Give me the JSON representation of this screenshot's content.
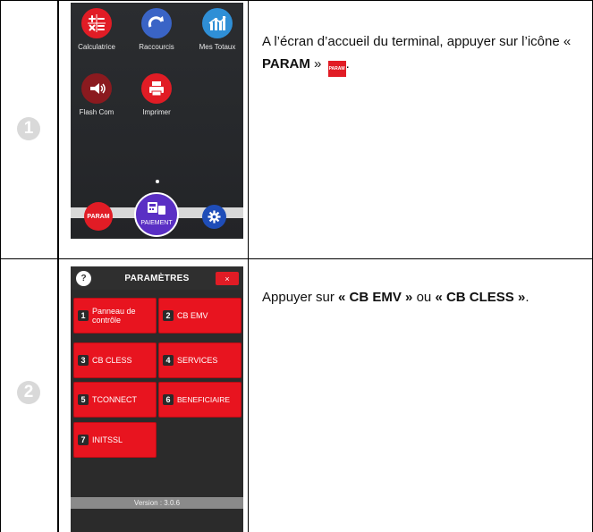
{
  "steps": [
    {
      "number": "1",
      "text_before": "A l’écran d’accueil du terminal, appuyer sur l’icône « ",
      "text_bold": "PARAM",
      "text_after": " »",
      "text_end": ".",
      "inline_icon_label": "PARAM",
      "screen": {
        "apps": [
          {
            "label": "Calculatrice",
            "icon": "calculator-icon",
            "color": "#e11c25"
          },
          {
            "label": "Raccourcis",
            "icon": "redo-arrow-icon",
            "color": "#3a64c6"
          },
          {
            "label": "Mes Totaux",
            "icon": "bar-chart-icon",
            "color": "#2f8fd6"
          },
          {
            "label": "Flash Com",
            "icon": "megaphone-icon",
            "color": "#8b1a1f"
          },
          {
            "label": "Imprimer",
            "icon": "printer-icon",
            "color": "#e11c25"
          }
        ],
        "dock": {
          "param_label": "PARAM",
          "payment_label": "PAIEMENT",
          "settings_icon": "gear-icon"
        }
      }
    },
    {
      "number": "2",
      "text_before": "Appuyer sur ",
      "bold1": "« CB EMV »",
      "mid": " ou ",
      "bold2": "« CB CLESS »",
      "text_after": ".",
      "screen": {
        "help_label": "?",
        "title": "PARAMÈTRES",
        "close_label": "×",
        "tiles": [
          {
            "num": "1",
            "label": "Panneau de contrôle"
          },
          {
            "num": "2",
            "label": "CB EMV"
          },
          {
            "num": "3",
            "label": "CB CLESS"
          },
          {
            "num": "4",
            "label": "SERVICES"
          },
          {
            "num": "5",
            "label": "TCONNECT"
          },
          {
            "num": "6",
            "label": "BENEFICIAIRE"
          },
          {
            "num": "7",
            "label": "INITSSL"
          }
        ],
        "version": "Version : 3.0.6"
      }
    }
  ],
  "colors": {
    "accent_red": "#e11c25",
    "payment_purple": "#5a2fc4",
    "settings_blue": "#1f4db8"
  }
}
